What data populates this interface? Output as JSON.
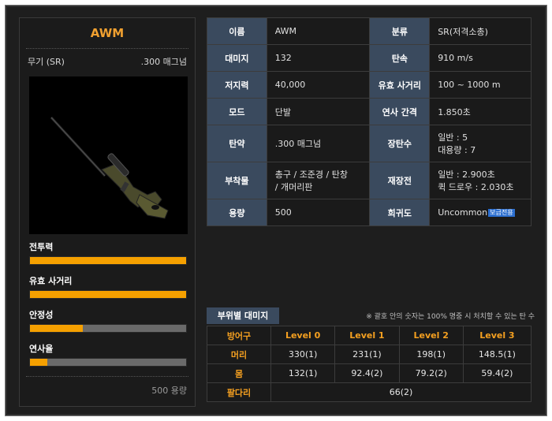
{
  "weapon": {
    "name": "AWM",
    "type_label": "무기 (SR)",
    "ammo_label": ".300 매그넘",
    "capacity_note": "500 용량"
  },
  "stats": [
    {
      "label": "전투력",
      "fill": 1.0
    },
    {
      "label": "유효 사거리",
      "fill": 1.0
    },
    {
      "label": "안정성",
      "fill": 0.34
    },
    {
      "label": "연사율",
      "fill": 0.11
    }
  ],
  "info": {
    "name_key": "이름",
    "name_val": "AWM",
    "class_key": "분류",
    "class_val": "SR(저격소총)",
    "damage_key": "대미지",
    "damage_val": "132",
    "speed_key": "탄속",
    "speed_val": "910 m/s",
    "stop_key": "저지력",
    "stop_val": "40,000",
    "range_key": "유효 사거리",
    "range_val": "100 ~ 1000 m",
    "mode_key": "모드",
    "mode_val": "단발",
    "interval_key": "연사 간격",
    "interval_val": "1.850초",
    "ammo_key": "탄약",
    "ammo_val": ".300 매그넘",
    "mag_key": "장탄수",
    "mag_val_1": "일반 : 5",
    "mag_val_2": "대용량 : 7",
    "attach_key": "부착물",
    "attach_val_1": "총구 / 조준경 / 탄창",
    "attach_val_2": "/ 개머리판",
    "reload_key": "재장전",
    "reload_val_1": "일반 : 2.900초",
    "reload_val_2": "퀵 드로우 : 2.030초",
    "cap_key": "용량",
    "cap_val": "500",
    "rarity_key": "희귀도",
    "rarity_val": "Uncommon",
    "rarity_badge": "보급전용"
  },
  "damage": {
    "tab_label": "부위별 대미지",
    "note": "※ 괄호 안의 숫자는 100% 명중 시 처치할 수 있는 탄 수",
    "headers": [
      "방어구",
      "Level 0",
      "Level 1",
      "Level 2",
      "Level 3"
    ],
    "head_label": "머리",
    "head": [
      "330(1)",
      "231(1)",
      "198(1)",
      "148.5(1)"
    ],
    "body_label": "몸",
    "body": [
      "132(1)",
      "92.4(2)",
      "79.2(2)",
      "59.4(2)"
    ],
    "limb_label": "팔다리",
    "limb_val": "66(2)"
  },
  "colors": {
    "accent": "#f5a000",
    "header_bg": "#3a4a5e",
    "panel_bg": "#1b1b1b"
  }
}
